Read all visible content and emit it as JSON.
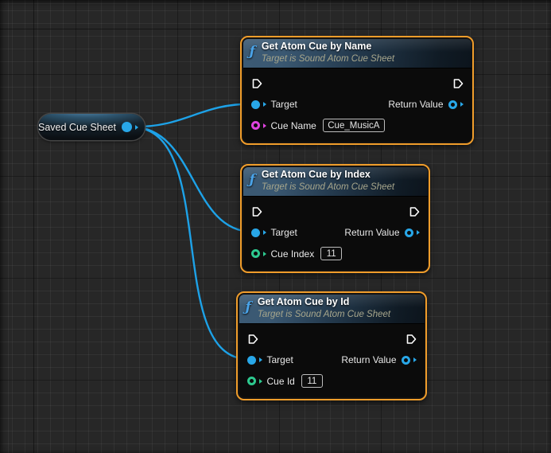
{
  "variable_node": {
    "label": "Saved Cue Sheet"
  },
  "nodes": [
    {
      "title": "Get Atom Cue by Name",
      "subtitle": "Target is Sound Atom Cue Sheet",
      "target_label": "Target",
      "return_label": "Return Value",
      "param_label": "Cue Name",
      "param_value": "Cue_MusicA"
    },
    {
      "title": "Get Atom Cue by Index",
      "subtitle": "Target is Sound Atom Cue Sheet",
      "target_label": "Target",
      "return_label": "Return Value",
      "param_label": "Cue Index",
      "param_value": "11"
    },
    {
      "title": "Get Atom Cue by Id",
      "subtitle": "Target is Sound Atom Cue Sheet",
      "target_label": "Target",
      "return_label": "Return Value",
      "param_label": "Cue Id",
      "param_value": "11"
    }
  ],
  "icons": {
    "function_glyph": "ƒ"
  },
  "colors": {
    "wire_blue": "#1da2e8",
    "pin_blue": "#28a7e8",
    "pin_name": "#df43df",
    "pin_int": "#2dc98f",
    "selection_orange": "#f09d2b",
    "canvas_background": "#272727"
  }
}
